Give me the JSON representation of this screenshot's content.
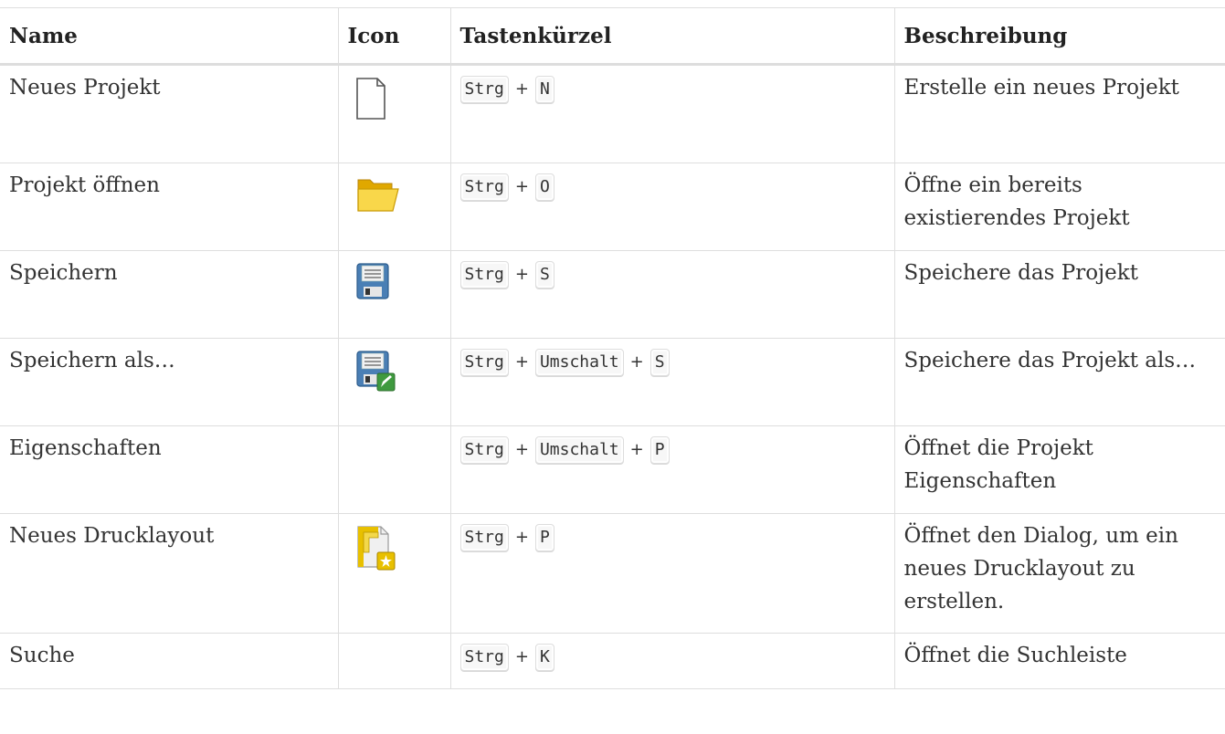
{
  "header": {
    "name": "Name",
    "icon": "Icon",
    "keys": "Tastenkürzel",
    "description": "Beschreibung"
  },
  "rows": [
    {
      "name": "Neues Projekt",
      "icon": "new-file-icon",
      "keys": [
        "Strg",
        "N"
      ],
      "description": "Erstelle ein neues Projekt"
    },
    {
      "name": "Projekt öffnen",
      "icon": "open-folder-icon",
      "keys": [
        "Strg",
        "O"
      ],
      "description": "Öffne ein bereits existierendes Projekt"
    },
    {
      "name": "Speichern",
      "icon": "save-icon",
      "keys": [
        "Strg",
        "S"
      ],
      "description": "Speichere das Projekt"
    },
    {
      "name": "Speichern als…",
      "icon": "save-as-icon",
      "keys": [
        "Strg",
        "Umschalt",
        "S"
      ],
      "description": "Speichere das Projekt als…"
    },
    {
      "name": "Eigenschaften",
      "icon": "",
      "keys": [
        "Strg",
        "Umschalt",
        "P"
      ],
      "description": "Öffnet die Projekt Eigenschaften"
    },
    {
      "name": "Neues Drucklayout",
      "icon": "new-print-layout-icon",
      "keys": [
        "Strg",
        "P"
      ],
      "description": "Öffnet den Dialog, um ein neues Drucklayout zu erstellen."
    },
    {
      "name": "Suche",
      "icon": "",
      "keys": [
        "Strg",
        "K"
      ],
      "description": "Öffnet die Suchleiste"
    }
  ],
  "key_separator": "+",
  "colors": {
    "border": "#dedede",
    "folder": "#f5c518",
    "floppy": "#4a7fb5",
    "pencil": "#3f9a3f",
    "layout_yellow": "#e8c000"
  }
}
